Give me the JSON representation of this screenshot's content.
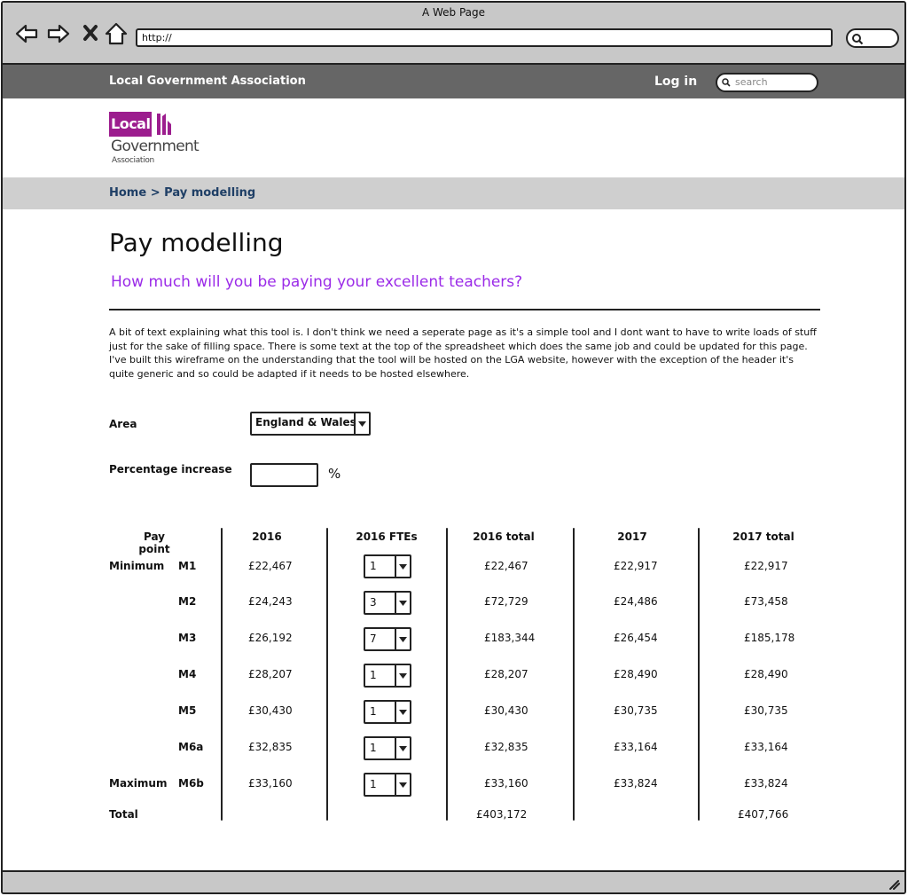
{
  "browser": {
    "window_title": "A Web Page",
    "url": "http://"
  },
  "header": {
    "site_name": "Local Government Association",
    "login_label": "Log in",
    "search_placeholder": "search"
  },
  "logo": {
    "line1": "Local",
    "line2": "Government",
    "line3": "Association"
  },
  "breadcrumb": {
    "home": "Home",
    "separator": ">",
    "current": "Pay modelling"
  },
  "page": {
    "title": "Pay modelling",
    "subtitle": "How much will you be paying your excellent teachers?",
    "intro": "A bit of text explaining what this tool is. I don't think we need a seperate page as it's a simple tool and I dont want to have to write loads of stuff just for the sake of filling space. There is some text at the top of the spreadsheet which does the same job and could be updated for this page. I've built this wireframe on the understanding that the tool will be hosted on the LGA website, however with the exception of the header it's quite generic and so could be adapted if it needs to be hosted elsewhere."
  },
  "form": {
    "area_label": "Area",
    "area_value": "England & Wales",
    "pct_label": "Percentage increase",
    "pct_value": "",
    "pct_unit": "%"
  },
  "table": {
    "headers": {
      "pay_point": "Pay point",
      "y2016": "2016",
      "fte2016": "2016 FTEs",
      "total2016": "2016 total",
      "y2017": "2017",
      "total2017": "2017 total"
    },
    "rows": [
      {
        "group": "Minimum",
        "point": "M1",
        "pay2016": "£22,467",
        "fte": "1",
        "total2016": "£22,467",
        "pay2017": "£22,917",
        "total2017": "£22,917"
      },
      {
        "group": "",
        "point": "M2",
        "pay2016": "£24,243",
        "fte": "3",
        "total2016": "£72,729",
        "pay2017": "£24,486",
        "total2017": "£73,458"
      },
      {
        "group": "",
        "point": "M3",
        "pay2016": "£26,192",
        "fte": "7",
        "total2016": "£183,344",
        "pay2017": "£26,454",
        "total2017": "£185,178"
      },
      {
        "group": "",
        "point": "M4",
        "pay2016": "£28,207",
        "fte": "1",
        "total2016": "£28,207",
        "pay2017": "£28,490",
        "total2017": "£28,490"
      },
      {
        "group": "",
        "point": "M5",
        "pay2016": "£30,430",
        "fte": "1",
        "total2016": "£30,430",
        "pay2017": "£30,735",
        "total2017": "£30,735"
      },
      {
        "group": "",
        "point": "M6a",
        "pay2016": "£32,835",
        "fte": "1",
        "total2016": "£32,835",
        "pay2017": "£33,164",
        "total2017": "£33,164"
      },
      {
        "group": "Maximum",
        "point": "M6b",
        "pay2016": "£33,160",
        "fte": "1",
        "total2016": "£33,160",
        "pay2017": "£33,824",
        "total2017": "£33,824"
      }
    ],
    "total_label": "Total",
    "total2016": "£403,172",
    "total2017": "£407,766"
  },
  "colors": {
    "header_bg": "#666666",
    "breadcrumb_bg": "#cfcfcf",
    "subtitle": "#9b2be8",
    "logo": "#9c1d8e",
    "link": "#1f3f66"
  },
  "icons": [
    "back-arrow-icon",
    "forward-arrow-icon",
    "close-icon",
    "home-icon",
    "search-icon",
    "chevron-down-icon",
    "resize-grip-icon"
  ]
}
